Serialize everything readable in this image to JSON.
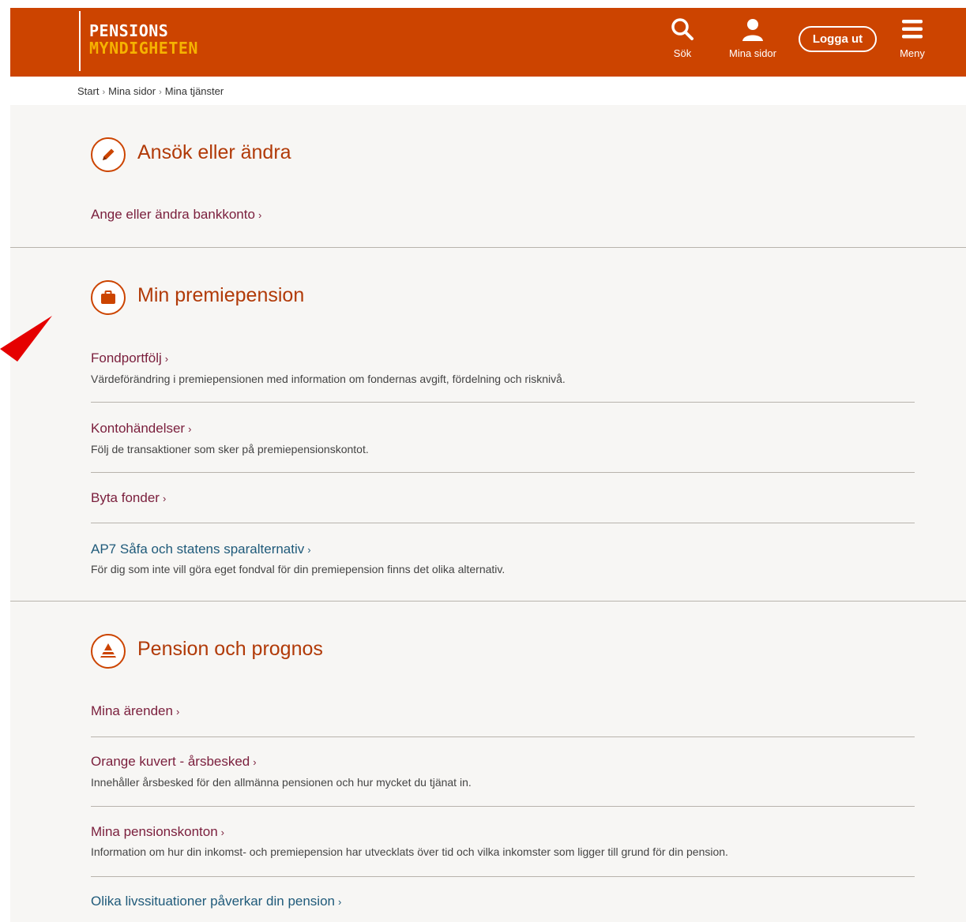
{
  "header": {
    "logo_line1": "PENSIONS",
    "logo_line2": "MYNDIGHETEN",
    "search_label": "Sök",
    "mina_sidor_label": "Mina sidor",
    "logout_label": "Logga ut",
    "menu_label": "Meny"
  },
  "breadcrumb": {
    "items": [
      "Start",
      "Mina sidor",
      "Mina tjänster"
    ],
    "separator": "›"
  },
  "sections": [
    {
      "title": "Ansök eller ändra",
      "icon": "pencil-icon",
      "links": [
        {
          "label": "Ange eller ändra bankkonto",
          "desc": ""
        }
      ]
    },
    {
      "title": "Min premiepension",
      "icon": "briefcase-icon",
      "links": [
        {
          "label": "Fondportfölj",
          "desc": "Värdeförändring i premiepensionen med information om fondernas avgift, fördelning och risknivå."
        },
        {
          "label": "Kontohändelser",
          "desc": "Följ de transaktioner som sker på premiepensionskontot."
        },
        {
          "label": "Byta fonder",
          "desc": ""
        },
        {
          "label": "AP7 Såfa och statens sparalternativ",
          "desc": "För dig som inte vill göra eget fondval för din premiepension finns det olika alternativ."
        }
      ]
    },
    {
      "title": "Pension och prognos",
      "icon": "pyramid-icon",
      "links": [
        {
          "label": "Mina ärenden",
          "desc": ""
        },
        {
          "label": "Orange kuvert - årsbesked",
          "desc": "Innehåller årsbesked för den allmänna pensionen och hur mycket du tjänat in."
        },
        {
          "label": "Mina pensionskonton",
          "desc": "Information om hur din inkomst- och premiepension har utvecklats över tid och vilka inkomster som ligger till grund för din pension."
        },
        {
          "label": "Olika livssituationer påverkar din pension",
          "desc": ""
        }
      ]
    }
  ],
  "chevron": "›",
  "colors": {
    "brand_orange": "#cc4400",
    "logo_yellow": "#f6b200",
    "link_maroon": "#7a1e3c",
    "link_blue": "#1f5a7a",
    "annotation_arrow": "#e50000"
  }
}
